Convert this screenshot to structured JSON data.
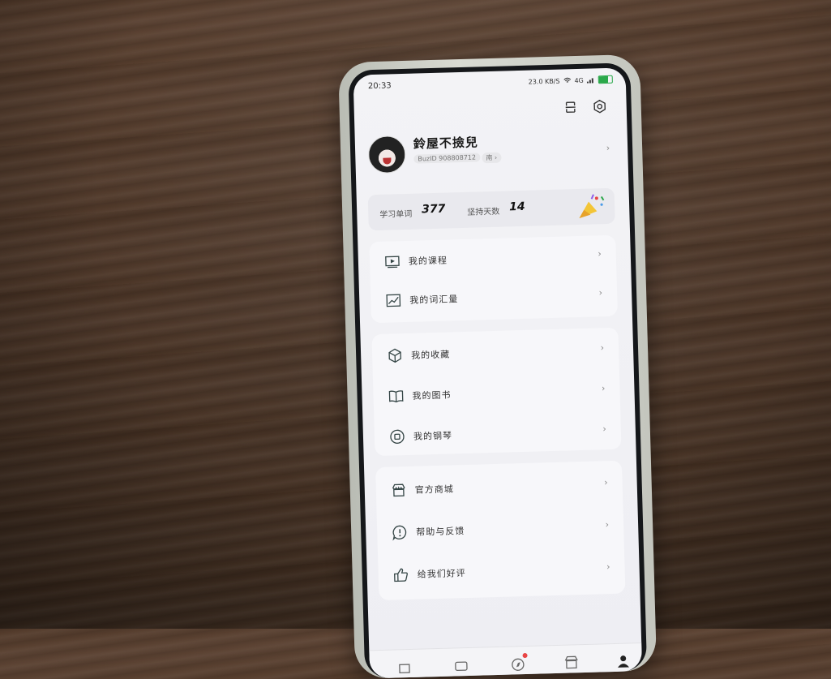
{
  "status": {
    "time": "20:33",
    "signal_text": "23.0 KB/S",
    "network": "4G"
  },
  "profile": {
    "username": "鈴屋不撿兒",
    "user_id": "BuzID 908808712",
    "gender_tag": "南 ›"
  },
  "stats": {
    "learned_words_label": "学习单词",
    "learned_words_value": "377",
    "streak_days_label": "坚持天数",
    "streak_days_value": "14"
  },
  "menu_group_1": [
    {
      "label": "我的课程",
      "icon": "video-play-icon"
    },
    {
      "label": "我的词汇量",
      "icon": "trend-chart-icon"
    }
  ],
  "menu_group_2": [
    {
      "label": "我的收藏",
      "icon": "cube-icon"
    },
    {
      "label": "我的图书",
      "icon": "book-icon"
    },
    {
      "label": "我的钢琴",
      "icon": "piano-circle-icon"
    }
  ],
  "menu_group_3": [
    {
      "label": "官方商城",
      "icon": "store-icon"
    },
    {
      "label": "帮助与反馈",
      "icon": "help-icon"
    },
    {
      "label": "给我们好评",
      "icon": "thumbs-up-icon"
    }
  ],
  "colors": {
    "accent_red": "#e84545",
    "battery_green": "#2aa84a"
  }
}
